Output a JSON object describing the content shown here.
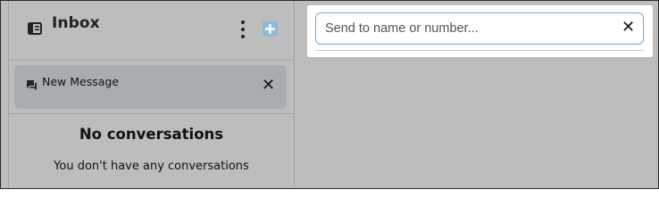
{
  "sidebar": {
    "title": "Inbox",
    "icons": {
      "inbox": "inbox-icon",
      "menu": "kebab-menu-icon",
      "compose": "plus-icon",
      "message": "chat-bubble-icon",
      "close": "close-icon"
    },
    "new_message": {
      "label": "New Message",
      "close_glyph": "✕"
    },
    "empty_state": {
      "title": "No conversations",
      "subtitle": "You don't have any conversations"
    }
  },
  "recipient": {
    "value": "",
    "placeholder": "Send to name or number...",
    "clear_glyph": "✕"
  },
  "colors": {
    "background": "#bdbdbd",
    "input_border": "#6aa7e0",
    "compose_button": "#8fb8d6",
    "new_message_bg": "#a9adb1"
  }
}
